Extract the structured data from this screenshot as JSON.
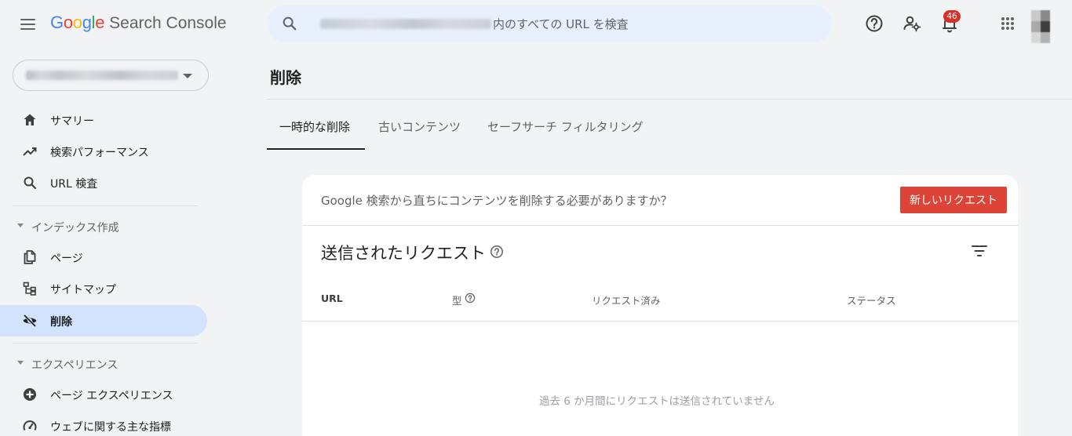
{
  "header": {
    "logo_letters": [
      {
        "ch": "G",
        "color": "#4285F4"
      },
      {
        "ch": "o",
        "color": "#EA4335"
      },
      {
        "ch": "o",
        "color": "#FBBC05"
      },
      {
        "ch": "g",
        "color": "#4285F4"
      },
      {
        "ch": "l",
        "color": "#34A853"
      },
      {
        "ch": "e",
        "color": "#EA4335"
      }
    ],
    "product_name": "Search Console",
    "search_placeholder": "内のすべての URL を検査",
    "notification_count": "46",
    "icons": [
      "menu-icon",
      "search-icon",
      "help-icon",
      "manage-users-icon",
      "bell-icon",
      "apps-icon"
    ]
  },
  "sidebar": {
    "items_top": [
      {
        "label": "サマリー",
        "icon": "home-icon"
      },
      {
        "label": "検索パフォーマンス",
        "icon": "trending-icon"
      },
      {
        "label": "URL 検査",
        "icon": "search-icon"
      }
    ],
    "section_index": {
      "title": "インデックス作成",
      "items": [
        {
          "label": "ページ",
          "icon": "pages-icon"
        },
        {
          "label": "サイトマップ",
          "icon": "sitemap-icon"
        },
        {
          "label": "削除",
          "icon": "eye-off-icon",
          "active": true
        }
      ]
    },
    "section_experience": {
      "title": "エクスペリエンス",
      "items": [
        {
          "label": "ページ エクスペリエンス",
          "icon": "plus-circle-icon"
        },
        {
          "label": "ウェブに関する主な指標",
          "icon": "speed-gauge-icon"
        }
      ]
    }
  },
  "main": {
    "page_title": "削除",
    "tabs": [
      {
        "label": "一時的な削除",
        "active": true
      },
      {
        "label": "古いコンテンツ",
        "active": false
      },
      {
        "label": "セーフサーチ フィルタリング",
        "active": false
      }
    ],
    "card": {
      "prompt": "Google 検索から直ちにコンテンツを削除する必要がありますか？",
      "new_request_label": "新しいリクエスト",
      "section_title": "送信されたリクエスト",
      "columns": [
        "URL",
        "型",
        "リクエスト済み",
        "ステータス"
      ],
      "empty_message": "過去 6 か月間にリクエストは送信されていません"
    }
  },
  "colors": {
    "active_nav_bg": "#d3e3fd",
    "search_bg": "#e8f0fe",
    "primary_button": "#db4437",
    "badge": "#d93025"
  }
}
